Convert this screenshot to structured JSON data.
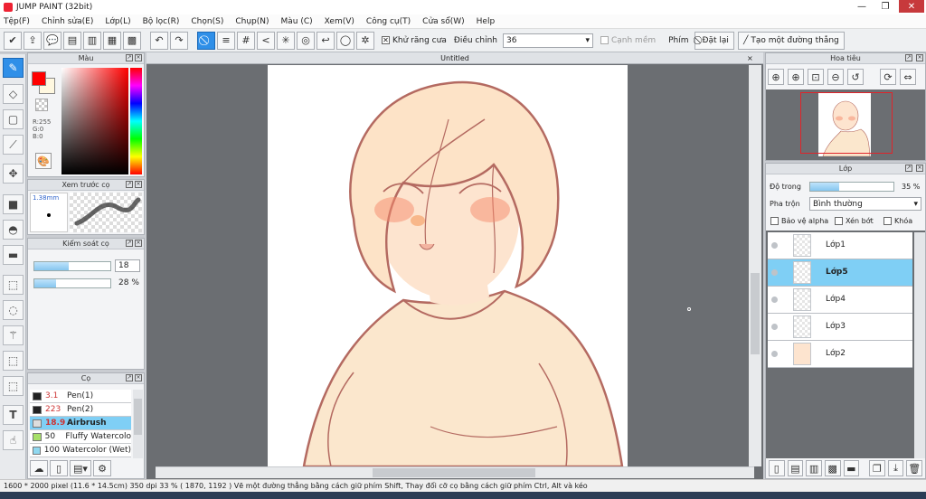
{
  "app": {
    "title": "JUMP PAINT (32bit)"
  },
  "menu": [
    "Tệp(F)",
    "Chỉnh sửa(E)",
    "Lớp(L)",
    "Bộ lọc(R)",
    "Chọn(S)",
    "Chụp(N)",
    "Màu (C)",
    "Xem(V)",
    "Công cụ(T)",
    "Cửa sổ(W)",
    "Help"
  ],
  "toolbar": {
    "antialias_label": "Khử răng cưa",
    "adjust_label": "Điều chỉnh",
    "adjust_value": "36",
    "edge_label": "Cạnh mềm",
    "key_label": "Phím",
    "reset_label": "Đặt lại",
    "straight_line_label": "Tạo một đường thẳng"
  },
  "color_panel": {
    "title": "Màu",
    "r": "R:255",
    "g": "G:0",
    "b": "B:0",
    "fg": "#ff0000",
    "bg": "#fff8e0"
  },
  "brush_preview": {
    "title": "Xem trước cọ",
    "size": "1.38mm"
  },
  "brush_control": {
    "title": "Kiểm soát cọ",
    "size_value": "18",
    "opacity_value": "28 %",
    "size_fill": 0.45,
    "opacity_fill": 0.28
  },
  "brush_list": {
    "title": "Cọ",
    "items": [
      {
        "size": "3.1",
        "name": "Pen(1)",
        "color": "#222222",
        "selected": false
      },
      {
        "size": "223",
        "name": "Pen(2)",
        "color": "#222222",
        "selected": false
      },
      {
        "size": "18.9",
        "name": "Airbrush",
        "color": "#dddddd",
        "selected": true
      },
      {
        "size": "50",
        "name": "Fluffy Watercolor",
        "color": "#a7e06a",
        "selected": false
      },
      {
        "size": "100",
        "name": "Watercolor (Wet)",
        "color": "#8fd8f0",
        "selected": false
      }
    ]
  },
  "canvas": {
    "title": "Untitled"
  },
  "navigator": {
    "title": "Hoa tiêu"
  },
  "layers": {
    "title": "Lớp",
    "opacity_label": "Độ trong",
    "opacity_value": "35 %",
    "opacity_fill": 0.35,
    "blend_label": "Pha trộn",
    "blend_value": "Bình thường",
    "protect_alpha": "Bảo vệ alpha",
    "clip": "Xén bớt",
    "lock": "Khóa",
    "items": [
      {
        "name": "Lớp1",
        "selected": false
      },
      {
        "name": "Lớp5",
        "selected": true
      },
      {
        "name": "Lớp4",
        "selected": false
      },
      {
        "name": "Lớp3",
        "selected": false
      },
      {
        "name": "Lớp2",
        "selected": false
      }
    ]
  },
  "status": {
    "text": "1600 * 2000 pixel   (11.6 * 14.5cm)   350 dpi   33 %   ( 1870, 1192 )   Vẽ một đường thẳng bằng cách giữ phím Shift, Thay đổi cỡ cọ bằng cách giữ phím Ctrl, Alt và kéo"
  }
}
